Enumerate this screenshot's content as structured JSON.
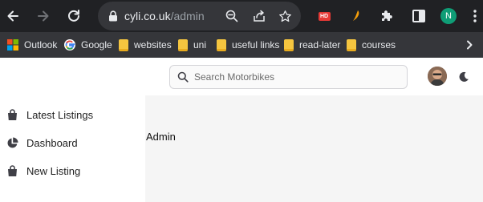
{
  "browser": {
    "url_host": "cyli.co.uk",
    "url_path": "/admin",
    "profile_initial": "N",
    "hd_badge": "HD"
  },
  "bookmarks": [
    {
      "label": "Outlook",
      "icon": "outlook-icon"
    },
    {
      "label": "Google",
      "icon": "google-icon"
    },
    {
      "label": "websites",
      "icon": "folder-icon"
    },
    {
      "label": "uni",
      "icon": "folder-icon"
    },
    {
      "label": "useful links",
      "icon": "folder-icon"
    },
    {
      "label": "read-later",
      "icon": "folder-icon"
    },
    {
      "label": "courses",
      "icon": "folder-icon"
    }
  ],
  "sidebar": {
    "items": [
      {
        "label": "Latest Listings",
        "icon": "shopping-bag-icon"
      },
      {
        "label": "Dashboard",
        "icon": "pie-chart-icon"
      },
      {
        "label": "New Listing",
        "icon": "shopping-bag-icon"
      }
    ]
  },
  "header": {
    "search_placeholder": "Search Motorbikes"
  },
  "main": {
    "heading": "Admin"
  }
}
